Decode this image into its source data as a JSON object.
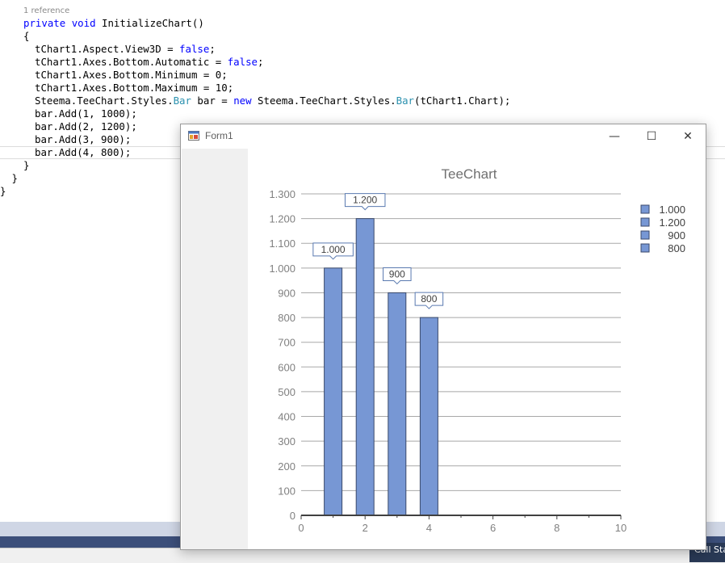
{
  "editor": {
    "codelens": "1 reference",
    "lines": [
      {
        "indent": 2,
        "tokens": [
          {
            "t": "private",
            "c": "kw"
          },
          {
            "t": " "
          },
          {
            "t": "void",
            "c": "kw"
          },
          {
            "t": " InitializeChart()"
          }
        ]
      },
      {
        "indent": 2,
        "tokens": [
          {
            "t": "{"
          }
        ]
      },
      {
        "indent": 3,
        "tokens": [
          {
            "t": "tChart1.Aspect.View3D = "
          },
          {
            "t": "false",
            "c": "kw"
          },
          {
            "t": ";"
          }
        ]
      },
      {
        "indent": 3,
        "tokens": [
          {
            "t": "tChart1.Axes.Bottom.Automatic = "
          },
          {
            "t": "false",
            "c": "kw"
          },
          {
            "t": ";"
          }
        ]
      },
      {
        "indent": 3,
        "tokens": [
          {
            "t": "tChart1.Axes.Bottom.Minimum = 0;"
          }
        ]
      },
      {
        "indent": 3,
        "tokens": [
          {
            "t": "tChart1.Axes.Bottom.Maximum = 10;"
          }
        ]
      },
      {
        "indent": 3,
        "tokens": [
          {
            "t": "Steema.TeeChart.Styles."
          },
          {
            "t": "Bar",
            "c": "ty"
          },
          {
            "t": " bar = "
          },
          {
            "t": "new",
            "c": "kw"
          },
          {
            "t": " Steema.TeeChart.Styles."
          },
          {
            "t": "Bar",
            "c": "ty"
          },
          {
            "t": "(tChart1.Chart);"
          }
        ]
      },
      {
        "indent": 3,
        "tokens": [
          {
            "t": "bar.Add(1, 1000);"
          }
        ]
      },
      {
        "indent": 3,
        "tokens": [
          {
            "t": "bar.Add(2, 1200);"
          }
        ]
      },
      {
        "indent": 3,
        "tokens": [
          {
            "t": "bar.Add(3, 900);"
          }
        ]
      },
      {
        "indent": 3,
        "tokens": [
          {
            "t": "bar.Add(4, 800);"
          }
        ]
      },
      {
        "indent": 2,
        "tokens": [
          {
            "t": "}"
          }
        ]
      },
      {
        "indent": 1,
        "tokens": [
          {
            "t": "}"
          }
        ]
      },
      {
        "indent": 0,
        "tokens": [
          {
            "t": "}"
          }
        ]
      }
    ]
  },
  "statusbar": {
    "right_label": "Call Stac"
  },
  "form": {
    "title": "Form1",
    "minimize": "—",
    "maximize": "☐",
    "close": "✕"
  },
  "colors": {
    "bar_fill": "#7797d4",
    "bar_stroke": "#3b4a6b",
    "grid": "#a8a8a8",
    "axis": "#404040",
    "label_text": "#404040",
    "tick_text": "#808080"
  },
  "chart_data": {
    "type": "bar",
    "title": "TeeChart",
    "x": [
      1,
      2,
      3,
      4
    ],
    "values": [
      1000,
      1200,
      900,
      800
    ],
    "value_labels": [
      "1.000",
      "1.200",
      "900",
      "800"
    ],
    "xlim": [
      0,
      10
    ],
    "ylim": [
      0,
      1300
    ],
    "xticks": [
      "0",
      "2",
      "4",
      "6",
      "8",
      "10"
    ],
    "yticks": [
      "0",
      "100",
      "200",
      "300",
      "400",
      "500",
      "600",
      "700",
      "800",
      "900",
      "1.000",
      "1.100",
      "1.200",
      "1.300"
    ],
    "grid": true,
    "legend": {
      "placement": "right",
      "entries": [
        "1.000",
        "1.200",
        "900",
        "800"
      ]
    }
  }
}
